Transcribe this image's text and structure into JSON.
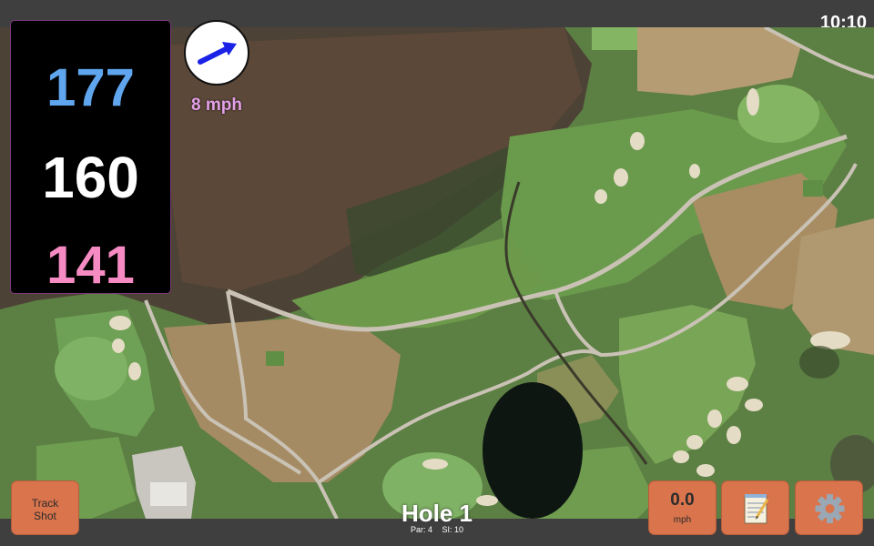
{
  "status_bar": {
    "time": "10:10"
  },
  "distances": {
    "back": "177",
    "center": "160",
    "front": "141"
  },
  "wind": {
    "speed": "8 mph",
    "direction_icon": "arrow-icon"
  },
  "hole": {
    "title": "Hole 1",
    "par": "Par: 4",
    "stroke_index": "SI: 10"
  },
  "buttons": {
    "track_shot_line1": "Track",
    "track_shot_line2": "Shot",
    "speed_value": "0.0",
    "speed_unit": "mph",
    "notes_icon": "notepad-icon",
    "settings_icon": "gear-icon"
  },
  "colors": {
    "back_distance": "#5fa6ee",
    "center_distance": "#ffffff",
    "front_distance": "#f58bc2",
    "wind_text": "#e2a0e6",
    "button": "#d9744c"
  }
}
